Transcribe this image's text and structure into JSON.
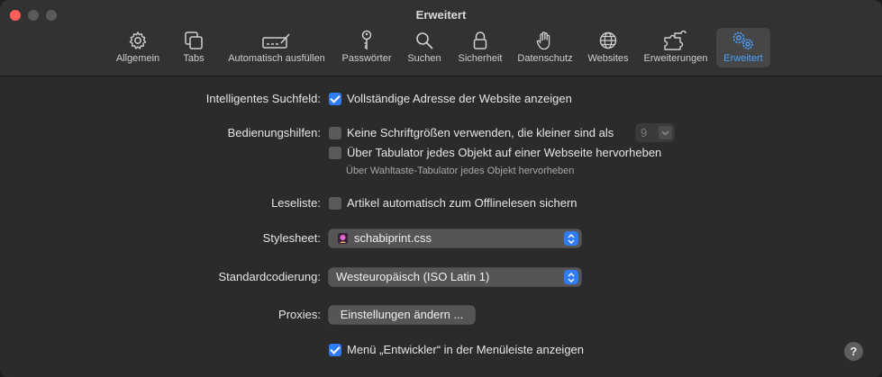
{
  "window": {
    "title": "Erweitert"
  },
  "toolbar": {
    "items": [
      {
        "label": "Allgemein",
        "icon": "gear-icon"
      },
      {
        "label": "Tabs",
        "icon": "tabs-icon"
      },
      {
        "label": "Automatisch ausfüllen",
        "icon": "autofill-icon"
      },
      {
        "label": "Passwörter",
        "icon": "key-icon"
      },
      {
        "label": "Suchen",
        "icon": "magnifier-icon"
      },
      {
        "label": "Sicherheit",
        "icon": "lock-icon"
      },
      {
        "label": "Datenschutz",
        "icon": "hand-icon"
      },
      {
        "label": "Websites",
        "icon": "globe-icon"
      },
      {
        "label": "Erweiterungen",
        "icon": "puzzle-icon"
      },
      {
        "label": "Erweitert",
        "icon": "gears-icon",
        "active": true
      }
    ],
    "accent": "#4aa3ff"
  },
  "settings": {
    "smart_search": {
      "label": "Intelligentes Suchfeld:",
      "option": "Vollständige Adresse der Website anzeigen",
      "checked": true
    },
    "accessibility": {
      "label": "Bedienungshilfen:",
      "option1": "Keine Schriftgrößen verwenden, die kleiner sind als",
      "option1_checked": false,
      "font_size": "9",
      "option2": "Über Tabulator jedes Objekt auf einer Webseite hervorheben",
      "option2_checked": false,
      "hint": "Über Wahltaste-Tabulator jedes Objekt hervorheben"
    },
    "reading_list": {
      "label": "Leseliste:",
      "option": "Artikel automatisch zum Offlinelesen sichern",
      "checked": false
    },
    "stylesheet": {
      "label": "Stylesheet:",
      "value": "schabiprint.css"
    },
    "encoding": {
      "label": "Standardcodierung:",
      "value": "Westeuropäisch (ISO Latin 1)"
    },
    "proxies": {
      "label": "Proxies:",
      "button": "Einstellungen ändern ..."
    },
    "develop_menu": {
      "option": "Menü „Entwickler“ in der Menüleiste anzeigen",
      "checked": true
    }
  },
  "help": {
    "label": "?"
  },
  "colors": {
    "checkbox_on": "#2f7cf6",
    "close": "#ff5f57"
  }
}
